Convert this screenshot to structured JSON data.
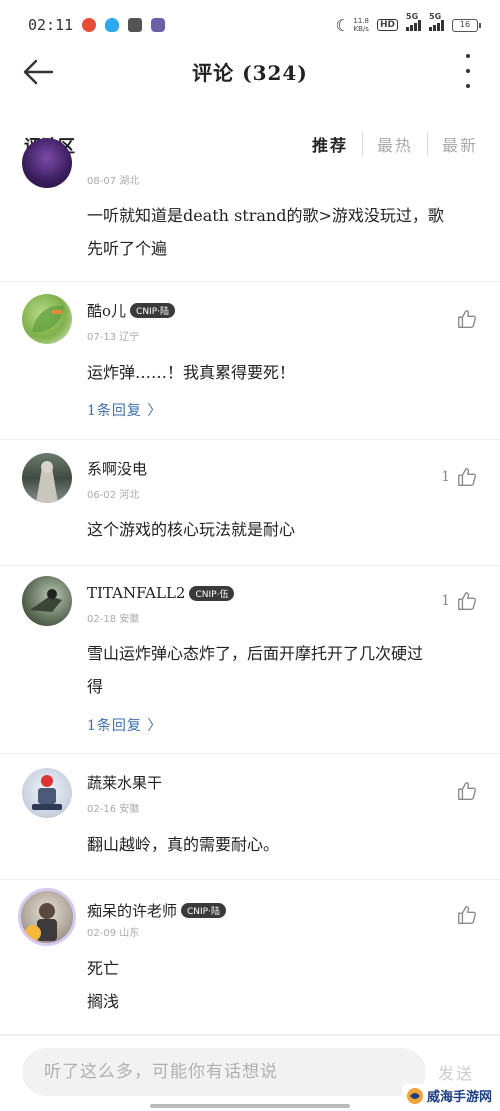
{
  "status_bar": {
    "time": "02:11",
    "net_speed_value": "11.8",
    "net_speed_unit": "KB/s",
    "hd_label": "HD",
    "signal1": "5G",
    "signal2": "5G",
    "battery": "16"
  },
  "nav": {
    "title": "评论 (324)"
  },
  "section": {
    "title": "评论区",
    "tabs": [
      "推荐",
      "最热",
      "最新"
    ]
  },
  "comments": [
    {
      "meta": "08-07 湖北",
      "lines": [
        "一听就知道是death strand的歌>游戏没玩过，歌",
        "先听了个遍"
      ]
    },
    {
      "name": "酷o儿",
      "badge": "CNIP·陆",
      "meta": "07-13 辽宁",
      "lines": [
        "运炸弹……！我真累得要死！"
      ],
      "reply": "1条回复 〉"
    },
    {
      "name": "系啊没电",
      "meta": "06-02 河北",
      "lines": [
        "这个游戏的核心玩法就是耐心"
      ],
      "likes": "1"
    },
    {
      "name": "TITANFALL2",
      "badge": "CNIP·伍",
      "meta": "02-18 安徽",
      "lines": [
        "雪山运炸弹心态炸了，后面开摩托开了几次硬过",
        "得"
      ],
      "reply": "1条回复 〉",
      "likes": "1"
    },
    {
      "name": "蔬莱水果干",
      "meta": "02-16 安徽",
      "lines": [
        "翻山越岭，真的需要耐心。"
      ]
    },
    {
      "name": "痴呆的许老师",
      "badge": "CNIP·陆",
      "meta": "02-09 山东",
      "lines": [
        "死亡",
        "搁浅"
      ]
    }
  ],
  "bottom": {
    "input_placeholder": "听了这么多，可能你有话想说",
    "send_label": "发送"
  },
  "watermark": {
    "text": "威海手游网"
  },
  "colors": {
    "reply_link": "#3f6fb0",
    "badge_bg": "#3a3a3a",
    "icon_gray": "#8a8a8a"
  }
}
